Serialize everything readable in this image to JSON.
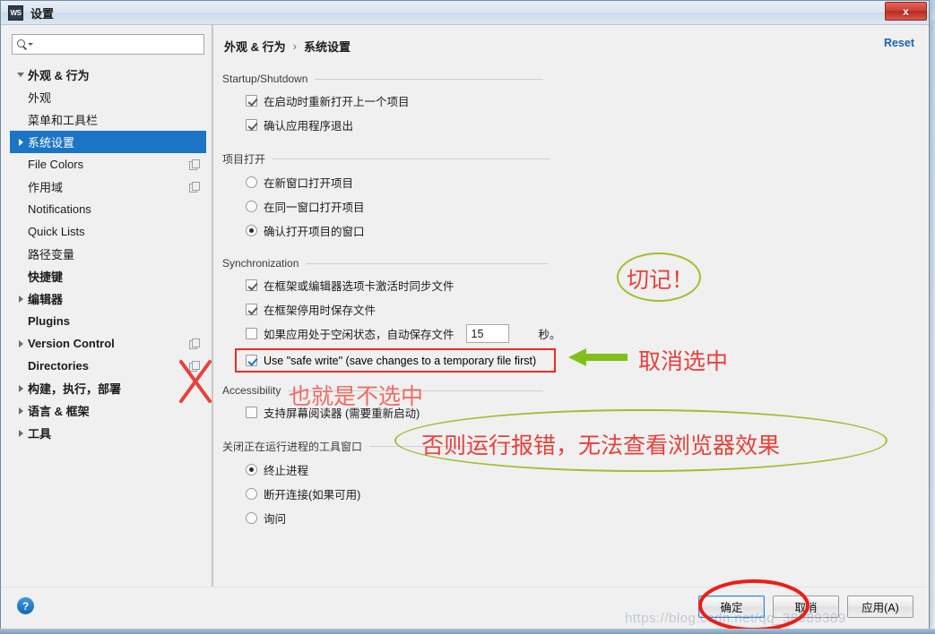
{
  "window": {
    "title": "设置",
    "app_icon_text": "WS",
    "close_label": "x"
  },
  "search": {
    "value": "",
    "placeholder": ""
  },
  "sidebar": {
    "items": [
      {
        "label": "外观 & 行为",
        "level": 0,
        "arrow": "down",
        "bold": true,
        "selected": false,
        "copy": false
      },
      {
        "label": "外观",
        "level": 1,
        "arrow": "none",
        "bold": false,
        "selected": false,
        "copy": false
      },
      {
        "label": "菜单和工具栏",
        "level": 1,
        "arrow": "none",
        "bold": false,
        "selected": false,
        "copy": false
      },
      {
        "label": "系统设置",
        "level": 1,
        "arrow": "right",
        "bold": false,
        "selected": true,
        "copy": false
      },
      {
        "label": "File Colors",
        "level": 1,
        "arrow": "none",
        "bold": false,
        "selected": false,
        "copy": true
      },
      {
        "label": "作用域",
        "level": 1,
        "arrow": "none",
        "bold": false,
        "selected": false,
        "copy": true
      },
      {
        "label": "Notifications",
        "level": 1,
        "arrow": "none",
        "bold": false,
        "selected": false,
        "copy": false
      },
      {
        "label": "Quick Lists",
        "level": 1,
        "arrow": "none",
        "bold": false,
        "selected": false,
        "copy": false
      },
      {
        "label": "路径变量",
        "level": 1,
        "arrow": "none",
        "bold": false,
        "selected": false,
        "copy": false
      },
      {
        "label": "快捷键",
        "level": 0,
        "arrow": "none",
        "bold": true,
        "selected": false,
        "copy": false
      },
      {
        "label": "编辑器",
        "level": 0,
        "arrow": "right",
        "bold": true,
        "selected": false,
        "copy": false
      },
      {
        "label": "Plugins",
        "level": 0,
        "arrow": "none",
        "bold": true,
        "selected": false,
        "copy": false
      },
      {
        "label": "Version Control",
        "level": 0,
        "arrow": "right",
        "bold": true,
        "selected": false,
        "copy": true
      },
      {
        "label": "Directories",
        "level": 0,
        "arrow": "none",
        "bold": true,
        "selected": false,
        "copy": true
      },
      {
        "label": "构建，执行，部署",
        "level": 0,
        "arrow": "right",
        "bold": true,
        "selected": false,
        "copy": false
      },
      {
        "label": "语言 & 框架",
        "level": 0,
        "arrow": "right",
        "bold": true,
        "selected": false,
        "copy": false
      },
      {
        "label": "工具",
        "level": 0,
        "arrow": "right",
        "bold": true,
        "selected": false,
        "copy": false
      }
    ]
  },
  "main": {
    "breadcrumb": {
      "parent": "外观 & 行为",
      "separator": "›",
      "current": "系统设置"
    },
    "reset_label": "Reset",
    "groups": {
      "startup": {
        "title": "Startup/Shutdown",
        "options": [
          {
            "label": "在启动时重新打开上一个项目",
            "checked": true
          },
          {
            "label": "确认应用程序退出",
            "checked": true
          }
        ]
      },
      "project_open": {
        "title": "项目打开",
        "options": [
          {
            "label": "在新窗口打开项目",
            "selected": false
          },
          {
            "label": "在同一窗口打开项目",
            "selected": false
          },
          {
            "label": "确认打开项目的窗口",
            "selected": true
          }
        ]
      },
      "synchronization": {
        "title": "Synchronization",
        "options": [
          {
            "label": "在框架或编辑器选项卡激活时同步文件",
            "checked": true
          },
          {
            "label": "在框架停用时保存文件",
            "checked": true
          }
        ],
        "idle_save": {
          "label": "如果应用处于空闲状态，自动保存文件",
          "checked": false,
          "value": "15",
          "unit": "秒。"
        },
        "safe_write": {
          "label": "Use \"safe write\" (save changes to a temporary file first)",
          "checked": true
        }
      },
      "accessibility": {
        "title": "Accessibility",
        "options": [
          {
            "label": "支持屏幕阅读器 (需要重新启动)",
            "checked": false
          }
        ]
      },
      "close_tool_window": {
        "title": "关闭正在运行进程的工具窗口",
        "options": [
          {
            "label": "终止进程",
            "selected": true
          },
          {
            "label": "断开连接(如果可用)",
            "selected": false
          },
          {
            "label": "询问",
            "selected": false
          }
        ]
      }
    }
  },
  "footer": {
    "help_label": "?",
    "buttons": [
      {
        "label": "确定",
        "default": true
      },
      {
        "label": "取消",
        "default": false
      },
      {
        "label": "应用(A)",
        "default": false
      }
    ]
  },
  "annotations": {
    "remember": "切记！",
    "uncheck": "取消选中",
    "means_uncheck": "也就是不选中",
    "warning": "否则运行报错，无法查看浏览器效果",
    "watermark": "https://blog.csdn.net/qq_38989389"
  },
  "colors": {
    "accent_blue": "#1c74c4",
    "link_blue": "#1567b2",
    "annotation_red": "#e8403a",
    "annotation_green": "#9fbf2f",
    "highlight_red": "#ec2a22",
    "close_red": "#d14236"
  }
}
